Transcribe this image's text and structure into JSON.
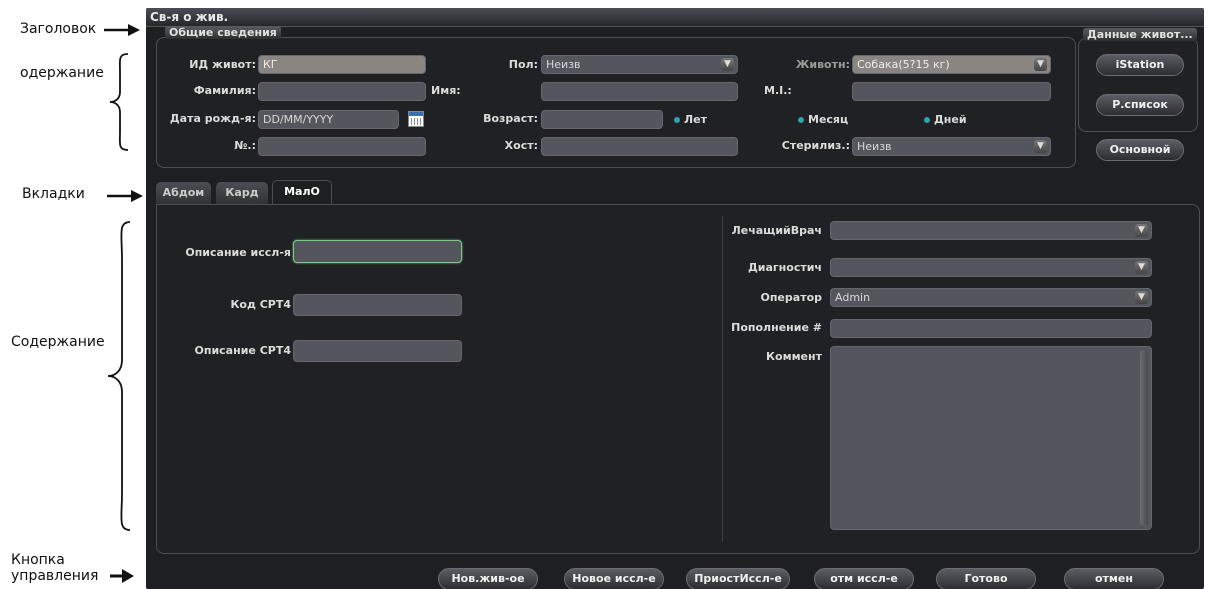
{
  "annotations": {
    "title": "Заголовок",
    "content_top": "одержание",
    "tabs": "Вкладки",
    "content_main": "Содержание",
    "control_line1": "Кнопка",
    "control_line2": "управления"
  },
  "window": {
    "title": "Св-я о жив."
  },
  "general": {
    "label": "Общие сведения",
    "patient_id_label": "ИД живот:",
    "patient_id_value": "КГ",
    "surname_label": "Фамилия:",
    "dob_label": "Дата рожд-я:",
    "dob_placeholder": "DD/MM/YYYY",
    "number_label": "№.:",
    "sex_label": "Пол:",
    "sex_value": "Неизв",
    "name_label": "Имя:",
    "age_label": "Возраст:",
    "owner_label": "Хост:",
    "age_unit_years": "Лет",
    "animal_label": "Животн:",
    "animal_value": "Собака(5?15 кг)",
    "mi_label": "M.I.:",
    "age_unit_months": "Месяц",
    "age_unit_days": "Дней",
    "sterilized_label": "Стерилиз.:",
    "sterilized_value": "Неизв"
  },
  "side": {
    "label": "Данные живот...",
    "istation": "iStation",
    "rlist": "Р.список",
    "main": "Основной"
  },
  "tabs": [
    "Абдом",
    "Кард",
    "МалО"
  ],
  "exam": {
    "desc_label": "Описание иссл-я",
    "cpt4_code_label": "Код CPT4",
    "cpt4_desc_label": "Описание CPT4",
    "doctor_label": "ЛечащийВрач",
    "diag_label": "Диагностич",
    "operator_label": "Оператор",
    "operator_value": "Admin",
    "accession_label": "Пополнение #",
    "comment_label": "Коммент"
  },
  "buttons": {
    "new_patient": "Нов.жив-ое",
    "new_exam": "Новое иссл-е",
    "pause_exam": "ПриостИссл-е",
    "cancel_exam": "отм иссл-е",
    "done": "Готово",
    "cancel": "отмен"
  }
}
